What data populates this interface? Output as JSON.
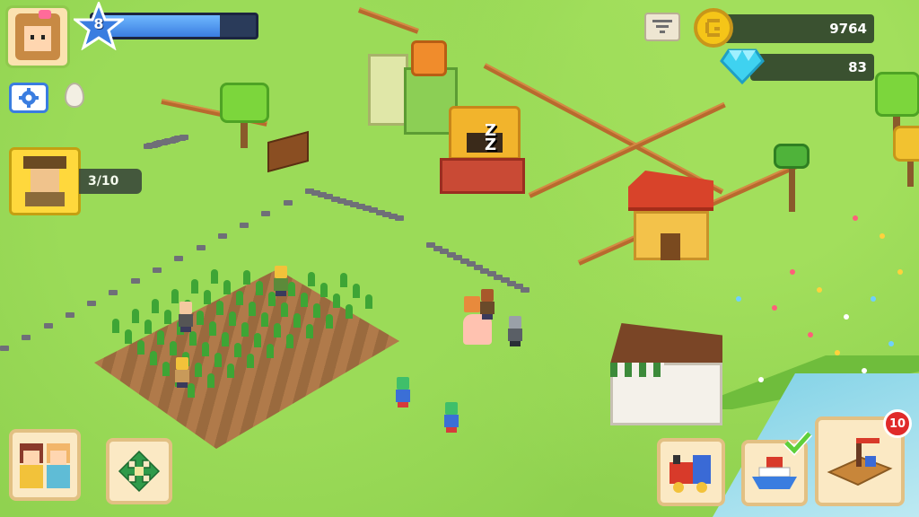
{
  "hud": {
    "level": "8",
    "xp_progress": 0.78,
    "visitor_count": "3/10",
    "coins": "9764",
    "gems": "83",
    "dock_badge": "10"
  },
  "oven": {
    "sleep_text": "Z\nZ"
  },
  "colors": {
    "xp": "#3a7de0",
    "coin": "#f5c518",
    "gem": "#3fd2f0",
    "badge": "#e02a2a",
    "grass": "#8fd14f"
  },
  "icons": {
    "settings": "gear-icon",
    "egg": "egg-icon",
    "filter": "filter-icon",
    "coin": "coin-icon",
    "gem": "gem-icon",
    "build": "move-arrows-icon",
    "check": "check-icon"
  }
}
